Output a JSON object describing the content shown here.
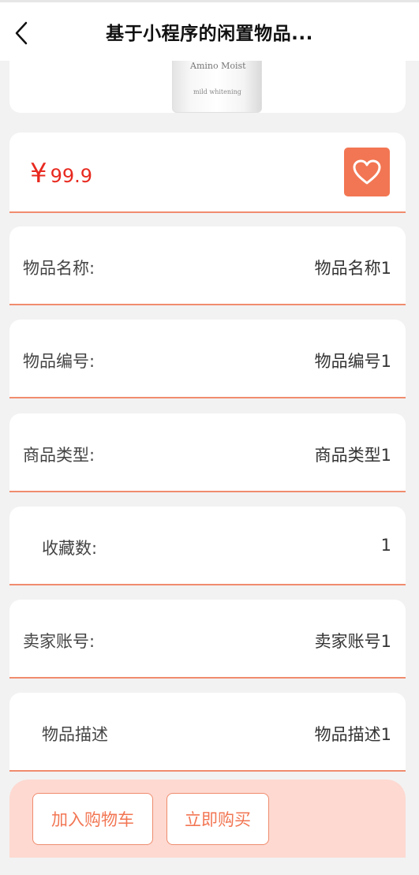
{
  "nav": {
    "title": "基于小程序的闲置物品..."
  },
  "product_image": {
    "line1": "Amino Moist",
    "line2": "mild whitening"
  },
  "price": {
    "symbol": "¥",
    "value": "99.9"
  },
  "colors": {
    "accent": "#f27653",
    "price": "#e8291f",
    "divider": "#f08c6e",
    "bottom_bar": "#fdd9d1"
  },
  "icons": {
    "back": "chevron-left-icon",
    "favorite": "heart-icon"
  },
  "fields": [
    {
      "label": "物品名称:",
      "value": "物品名称1"
    },
    {
      "label": "物品编号:",
      "value": "物品编号1"
    },
    {
      "label": "商品类型:",
      "value": "商品类型1"
    },
    {
      "label": "收藏数:",
      "value": "1"
    },
    {
      "label": "卖家账号:",
      "value": "卖家账号1"
    },
    {
      "label": "物品描述",
      "value": "物品描述1"
    }
  ],
  "actions": {
    "add_to_cart": "加入购物车",
    "buy_now": "立即购买"
  }
}
